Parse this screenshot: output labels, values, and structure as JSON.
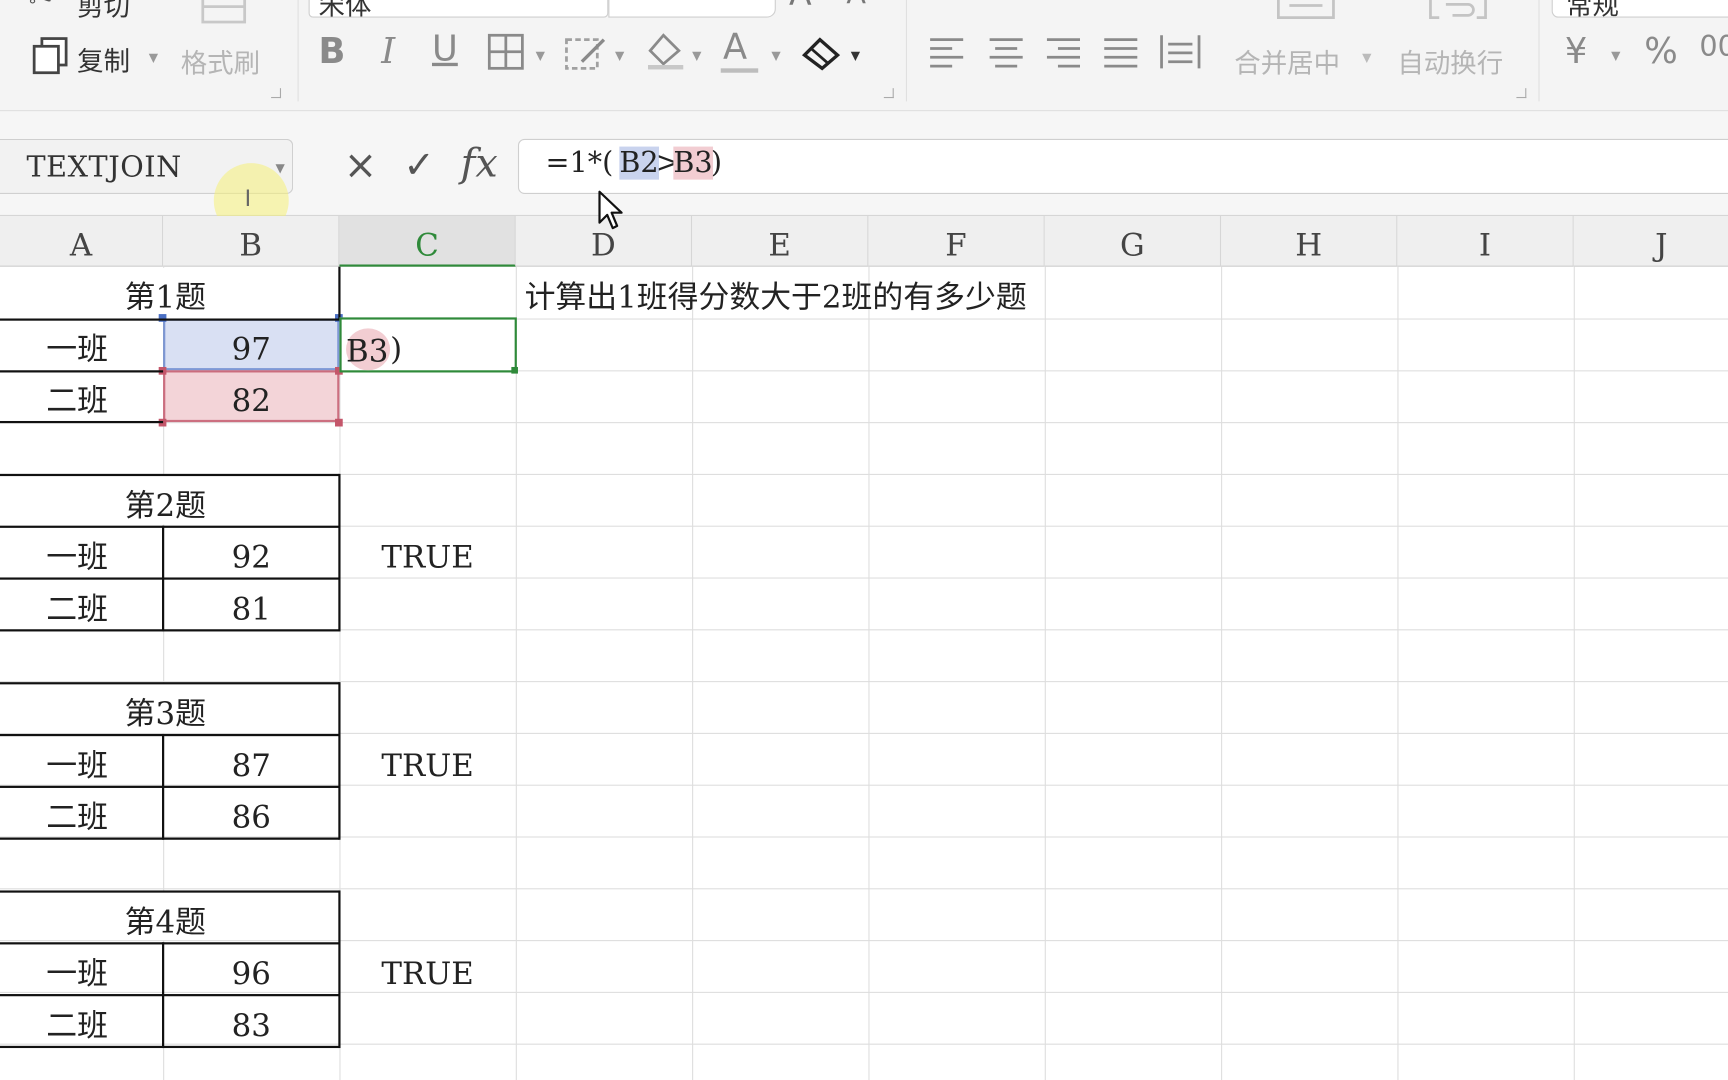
{
  "ribbon": {
    "cut_label": "剪切",
    "copy_label": "复制",
    "format_painter_label": "格式刷",
    "font_name": "宋体",
    "merge_center_label": "合并居中",
    "wrap_text_label": "自动换行",
    "number_format_label": "常规"
  },
  "formula_bar": {
    "name_box": "TEXTJOIN",
    "cancel_icon": "×",
    "confirm_icon": "✓",
    "fx_label": "fx",
    "formula_prefix": "=1*(",
    "ref1": "B2",
    "operator": ">",
    "ref2": "B3",
    "formula_suffix": ")"
  },
  "columns": [
    "A",
    "B",
    "C",
    "D",
    "E",
    "F",
    "G",
    "H",
    "I",
    "J"
  ],
  "active_column": "C",
  "sheet": {
    "note": "计算出1班得分数大于2班的有多少题",
    "editing_cell_text": {
      "ref": "B3",
      "suffix": ")"
    },
    "blocks": [
      {
        "title": "第1题",
        "class1_label": "一班",
        "class1_score": "97",
        "class2_label": "二班",
        "class2_score": "82",
        "result": ""
      },
      {
        "title": "第2题",
        "class1_label": "一班",
        "class1_score": "92",
        "class2_label": "二班",
        "class2_score": "81",
        "result": "TRUE"
      },
      {
        "title": "第3题",
        "class1_label": "一班",
        "class1_score": "87",
        "class2_label": "二班",
        "class2_score": "86",
        "result": "TRUE"
      },
      {
        "title": "第4题",
        "class1_label": "一班",
        "class1_score": "96",
        "class2_label": "二班",
        "class2_score": "83",
        "result": "TRUE"
      }
    ]
  },
  "colors": {
    "ref1_highlight": "#c9d3ee",
    "ref2_highlight": "#f2cdd2",
    "active_green": "#2f8a3a",
    "ref1_border": "#4a6fc4",
    "ref2_border": "#c4566a"
  }
}
